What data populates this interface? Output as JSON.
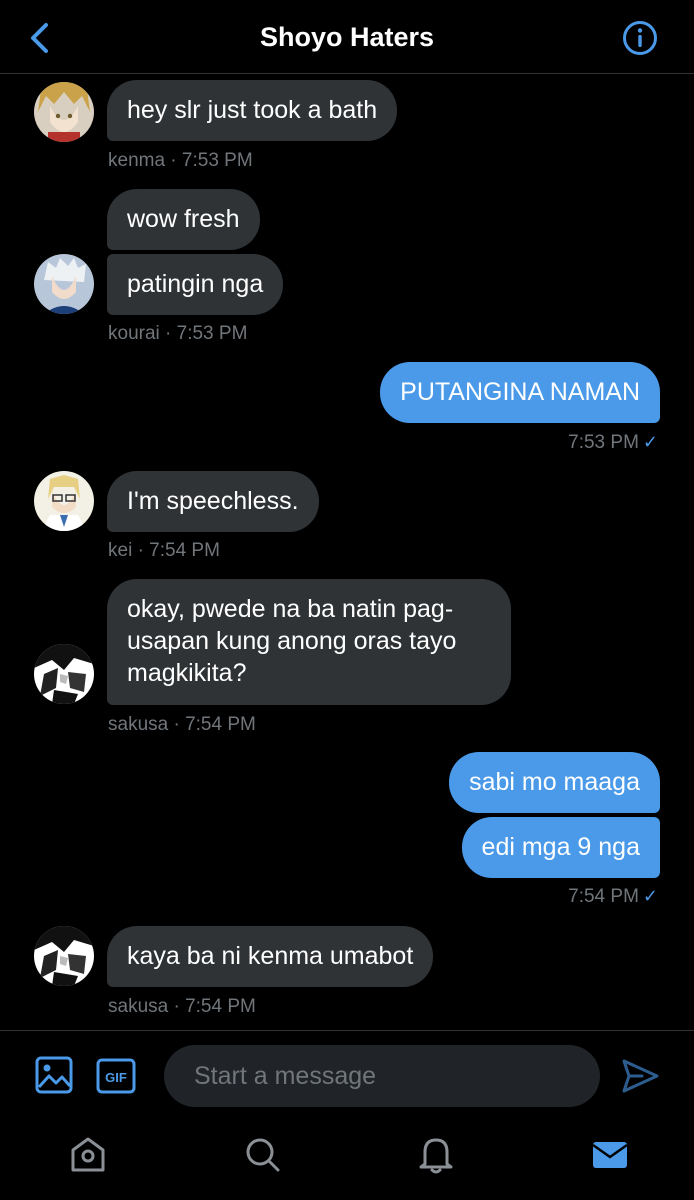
{
  "header": {
    "title": "Shoyo Haters"
  },
  "messages": [
    {
      "sender": "kenma",
      "text": "hey slr just took a bath",
      "meta": "kenma · 7:53 PM"
    },
    {
      "sender": "kourai",
      "text": "wow fresh"
    },
    {
      "sender": "kourai",
      "text": "patingin nga",
      "meta": "kourai · 7:53 PM"
    },
    {
      "sender": "me",
      "text": "PUTANGINA NAMAN",
      "meta": "7:53 PM"
    },
    {
      "sender": "kei",
      "text": "I'm speechless.",
      "meta": "kei · 7:54 PM"
    },
    {
      "sender": "sakusa",
      "text": "okay, pwede na ba natin pag-usapan kung anong oras tayo magkikita?",
      "meta": "sakusa · 7:54 PM"
    },
    {
      "sender": "me",
      "text": "sabi mo maaga"
    },
    {
      "sender": "me",
      "text": "edi mga 9 nga",
      "meta": "7:54 PM"
    },
    {
      "sender": "sakusa",
      "text": "kaya ba ni kenma umabot",
      "meta": "sakusa · 7:54 PM"
    }
  ],
  "composer": {
    "placeholder": "Start a message",
    "gif_label": "GIF"
  },
  "read_receipt_glyph": "✓",
  "colors": {
    "accent": "#4a9ae9",
    "incoming_bubble": "#2f3336",
    "background": "#000000",
    "meta_text": "#71767b"
  },
  "icons": {
    "header": [
      "back-chevron-icon",
      "info-icon"
    ],
    "composer": [
      "image-icon",
      "gif-icon",
      "send-icon"
    ],
    "tabs": [
      "home-icon",
      "search-icon",
      "notifications-bell-icon",
      "messages-envelope-icon"
    ]
  },
  "tabs": {
    "active": "messages"
  }
}
